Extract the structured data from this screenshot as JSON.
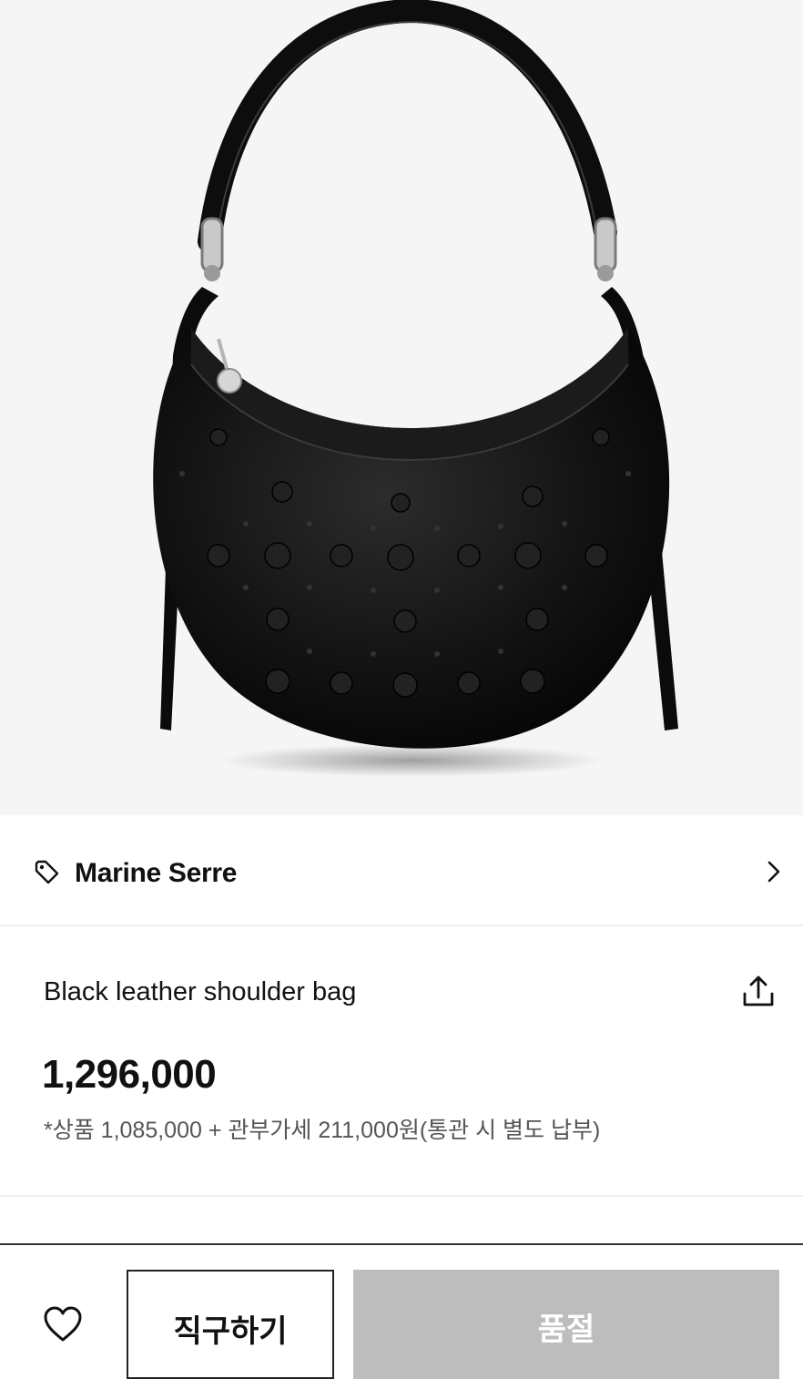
{
  "product": {
    "image_icon": "black-crescent-shoulder-bag-photo",
    "brand": "Marine Serre",
    "title": "Black leather shoulder bag",
    "price": "1,296,000",
    "price_note": "*상품 1,085,000 + 관부가세 211,000원(통관 시 별도 납부)"
  },
  "actions": {
    "buy_label": "직구하기",
    "soldout_label": "품절"
  },
  "icons": {
    "brand": "tag-icon",
    "brand_link": "chevron-right-icon",
    "share": "share-icon",
    "wishlist": "heart-icon"
  },
  "colors": {
    "soldout_bg": "#bdbdbd",
    "hero_bg": "#f5f5f5"
  }
}
